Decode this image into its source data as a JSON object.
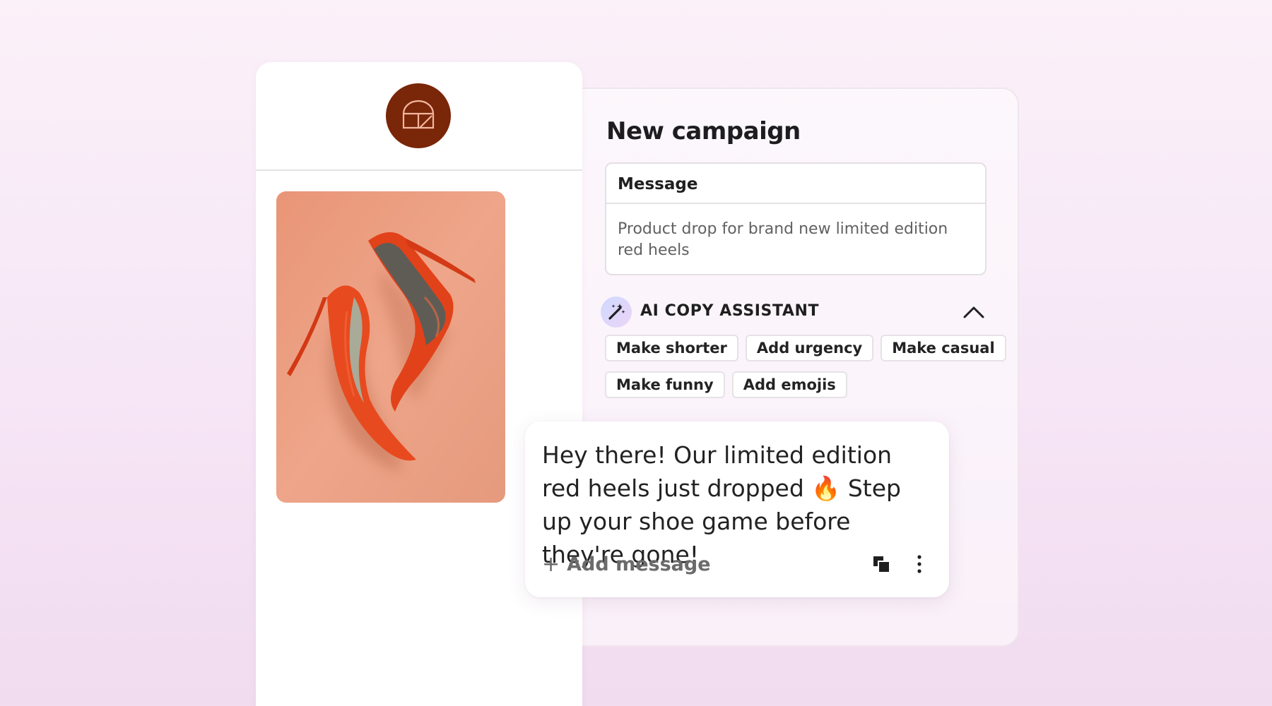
{
  "campaign": {
    "title": "New campaign",
    "message_label": "Message",
    "message_body": "Product drop for brand new limited edition red heels"
  },
  "assistant": {
    "title": "AI COPY ASSISTANT",
    "chips": [
      "Make shorter",
      "Add urgency",
      "Make casual",
      "Make funny",
      "Add emojis"
    ]
  },
  "output": {
    "text": "Hey there! Our limited edition red heels just dropped 🔥 Step up your shoe game before they're gone!",
    "add_message_label": "Add message",
    "add_icon": "+"
  },
  "icons": {
    "brand": "storefront-icon",
    "assistant": "magic-wand-icon",
    "collapse": "chevron-up-icon",
    "copy": "copy-icon",
    "more": "more-vertical-icon"
  },
  "colors": {
    "brand": "#7a2608",
    "product_background": "#e8a083",
    "heel": "#e8421a"
  }
}
